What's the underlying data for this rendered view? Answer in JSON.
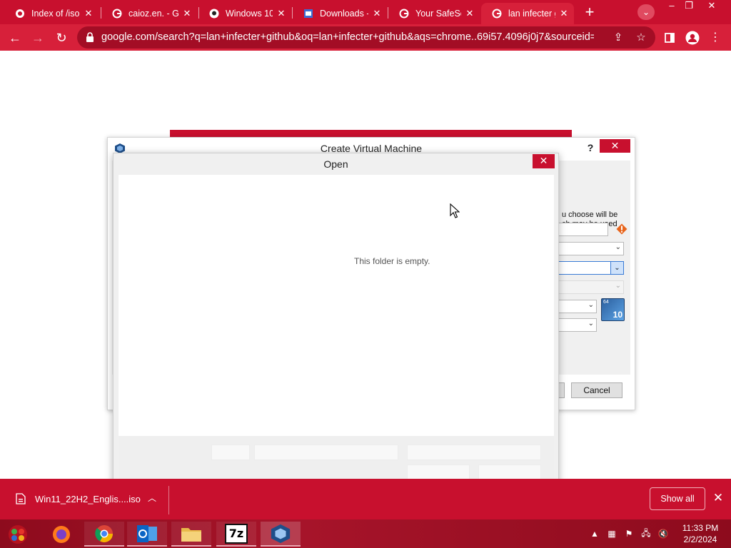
{
  "browser": {
    "tabs": [
      {
        "title": "Index of /iso",
        "favicon": "globe-icon"
      },
      {
        "title": "caioz.en. - G",
        "favicon": "google-icon"
      },
      {
        "title": "Windows 10",
        "favicon": "github-icon"
      },
      {
        "title": "Downloads -",
        "favicon": "doc-icon"
      },
      {
        "title": "Your SafeSe",
        "favicon": "google-icon"
      },
      {
        "title": "lan infecter g",
        "favicon": "google-icon"
      }
    ],
    "active_tab": 5,
    "new_tab_symbol": "+",
    "url": "google.com/search?q=lan+infecter+github&oq=lan+infecter+github&aqs=chrome..69i57.4096j0j7&sourceid=c..."
  },
  "cvm_dialog": {
    "title": "Create Virtual Machine",
    "help_label": "?",
    "description_line1": "u choose will be",
    "description_line2": "ch may be used",
    "cancel_label": "Cancel",
    "os_badge_bits": "64",
    "os_badge_version": "10"
  },
  "open_dialog": {
    "title": "Open",
    "empty_message": "This folder is empty."
  },
  "downloads": {
    "file_name": "Win11_22H2_Englis....iso",
    "show_all_label": "Show all"
  },
  "taskbar": {
    "apps": [
      "firefox",
      "chrome",
      "outlook",
      "file-explorer",
      "7zip",
      "virtualbox"
    ],
    "sevenzip_label": "7z",
    "time": "11:33 PM",
    "date": "2/2/2024"
  },
  "colors": {
    "chrome_accent": "#c8102e",
    "toolbar": "#d7203a",
    "omnibox": "#a30d25",
    "taskbar": "#a7142a"
  }
}
